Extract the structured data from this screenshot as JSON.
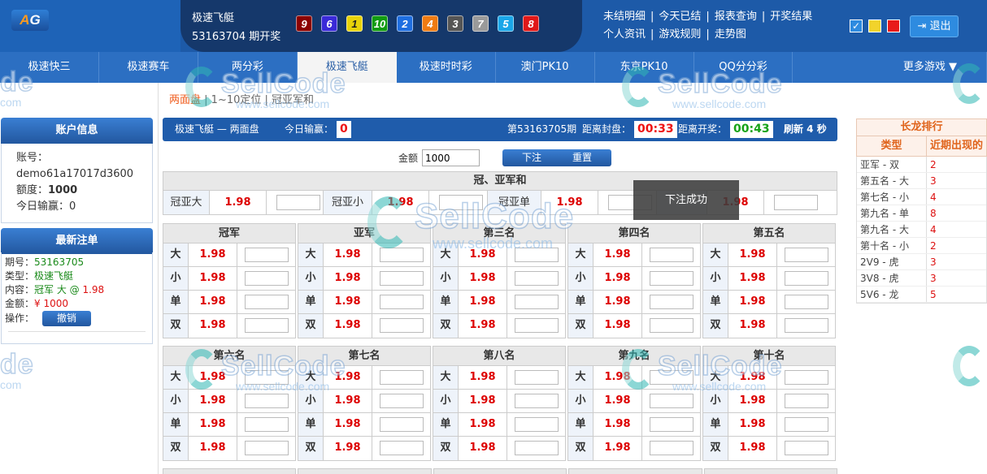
{
  "header": {
    "logo": {
      "a": "A",
      "g": "G"
    },
    "game_name": "极速飞艇",
    "draw_label": "53163704 期开奖",
    "balls": [
      {
        "n": "9",
        "color": "#8b0000"
      },
      {
        "n": "6",
        "color": "#3a2ad8"
      },
      {
        "n": "1",
        "color": "#e8d30a"
      },
      {
        "n": "10",
        "color": "#129b12"
      },
      {
        "n": "2",
        "color": "#1e6ee0"
      },
      {
        "n": "4",
        "color": "#f07b12"
      },
      {
        "n": "3",
        "color": "#555555"
      },
      {
        "n": "7",
        "color": "#9a9a9a"
      },
      {
        "n": "5",
        "color": "#1aa6e8"
      },
      {
        "n": "8",
        "color": "#e01818"
      }
    ],
    "links_row1": [
      "未结明细",
      "今天已结",
      "报表查询",
      "开奖结果"
    ],
    "links_row2": [
      "个人资讯",
      "游戏规则",
      "走势图"
    ],
    "swatch_colors": [
      "#2e8be0",
      "#f2d32b",
      "#e81a1a"
    ],
    "logout": "退出"
  },
  "nav": [
    "极速快三",
    "极速赛车",
    "两分彩",
    "极速飞艇",
    "极速时时彩",
    "澳门PK10",
    "东京PK10",
    "QQ分分彩",
    "更多游戏"
  ],
  "subnav": {
    "current": "两面盘",
    "items": [
      "1~10定位",
      "冠亚军和"
    ]
  },
  "account": {
    "title": "账户信息",
    "account_label": "账号：",
    "account_value": "demo61a17017d3600",
    "quota_label": "额度：",
    "quota_value": "1000",
    "today_label": "今日输赢：",
    "today_value": "0"
  },
  "recent": {
    "title": "最新注单",
    "period_label": "期号：",
    "period_value": "53163705",
    "type_label": "类型：",
    "type_value": "极速飞艇",
    "content_label": "内容：",
    "content_value": "冠军 大 @ ",
    "content_odds": "1.98",
    "amount_label": "金额：",
    "amount_value": "¥ 1000",
    "op_label": "操作：",
    "cancel": "撤销"
  },
  "infobar": {
    "title": "极速飞艇 — 两面盘",
    "today_label": "今日输赢：",
    "today_value": "0",
    "period": "第53163705期",
    "close_label": "距离封盘：",
    "close_value": "00:33",
    "open_label": "距离开奖：",
    "open_value": "00:43",
    "refresh": "刷新 4 秒"
  },
  "bet": {
    "amount_label": "金额",
    "amount_value": "1000",
    "submit": "下注",
    "reset": "重置"
  },
  "sum": {
    "title": "冠、亚军和",
    "items": [
      {
        "label": "冠亚大",
        "odds": "1.98"
      },
      {
        "label": "冠亚小",
        "odds": "1.98"
      },
      {
        "label": "冠亚单",
        "odds": "1.98"
      },
      {
        "label": "",
        "odds": "1.98"
      }
    ]
  },
  "positions": [
    {
      "title": "冠军"
    },
    {
      "title": "亚军"
    },
    {
      "title": "第三名"
    },
    {
      "title": "第四名"
    },
    {
      "title": "第五名"
    },
    {
      "title": "第六名"
    },
    {
      "title": "第七名"
    },
    {
      "title": "第八名"
    },
    {
      "title": "第九名"
    },
    {
      "title": "第十名"
    }
  ],
  "bet_options": [
    {
      "key": "大",
      "odds": "1.98"
    },
    {
      "key": "小",
      "odds": "1.98"
    },
    {
      "key": "单",
      "odds": "1.98"
    },
    {
      "key": "双",
      "odds": "1.98"
    }
  ],
  "toast": "下注成功",
  "long_dragon": {
    "title": "长龙排行",
    "col1": "类型",
    "col2": "近期出现的",
    "rows": [
      {
        "type": "亚军 - 双",
        "n": "2"
      },
      {
        "type": "第五名 - 大",
        "n": "3"
      },
      {
        "type": "第七名 - 小",
        "n": "4"
      },
      {
        "type": "第九名 - 单",
        "n": "8"
      },
      {
        "type": "第九名 - 大",
        "n": "4"
      },
      {
        "type": "第十名 - 小",
        "n": "2"
      },
      {
        "type": "2V9 - 虎",
        "n": "3"
      },
      {
        "type": "3V8 - 虎",
        "n": "3"
      },
      {
        "type": "5V6 - 龙",
        "n": "5"
      }
    ]
  },
  "watermark": {
    "brand": "SellCode",
    "url": "www.sellcode.com",
    "fragment_left": "de",
    "fragment_url": "com"
  }
}
